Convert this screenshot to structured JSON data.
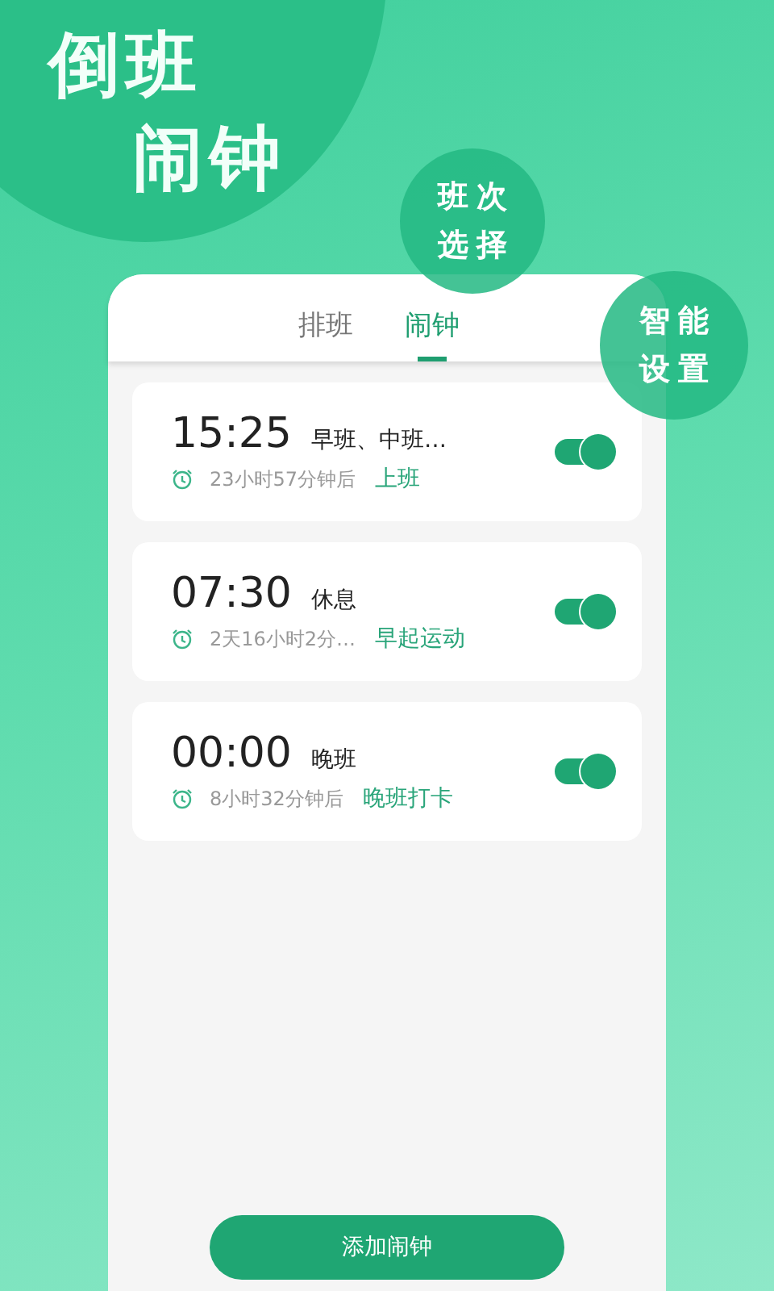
{
  "headline": [
    "倒班",
    "闹钟"
  ],
  "bubbles": [
    {
      "lines": [
        "班次",
        "选择"
      ]
    },
    {
      "lines": [
        "智能",
        "设置"
      ]
    }
  ],
  "tabs": [
    {
      "label": "排班",
      "selected": false
    },
    {
      "label": "闹钟",
      "selected": true
    }
  ],
  "alarms": [
    {
      "time": "15:25",
      "shifts": "早班、中班…",
      "countdown": "23小时57分钟后",
      "note": "上班",
      "on": true
    },
    {
      "time": "07:30",
      "shifts": "休息",
      "countdown": "2天16小时2分…",
      "note": "早起运动",
      "on": true
    },
    {
      "time": "00:00",
      "shifts": "晚班",
      "countdown": "8小时32分钟后",
      "note": "晚班打卡",
      "on": true
    }
  ],
  "add_button": "添加闹钟"
}
